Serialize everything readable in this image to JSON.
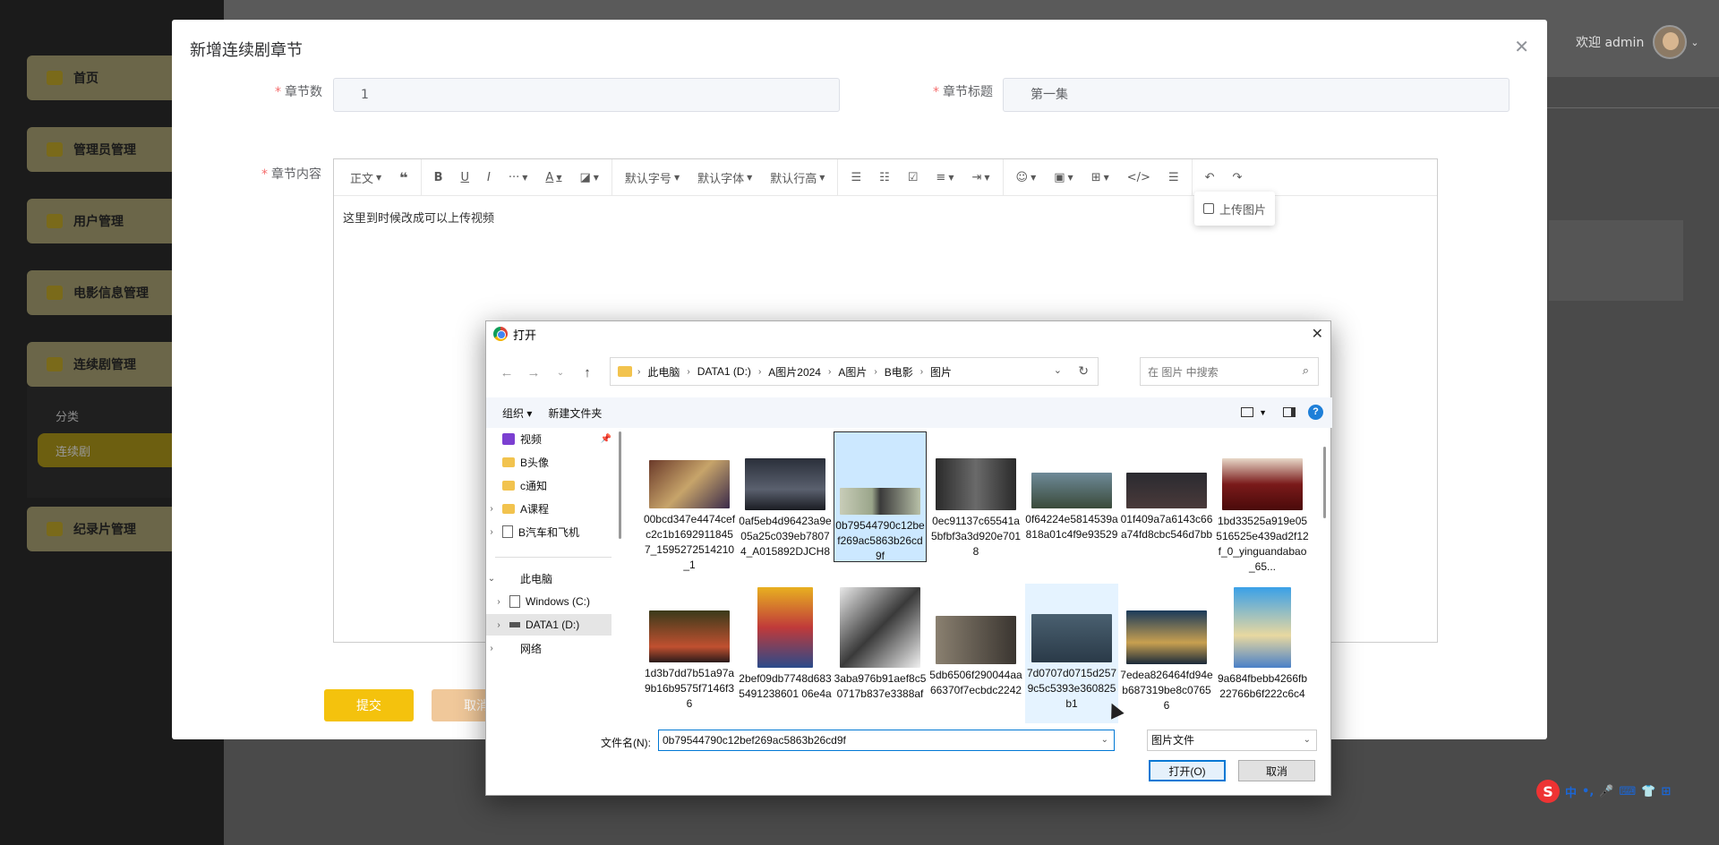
{
  "sidebar": {
    "items": [
      {
        "label": "首页"
      },
      {
        "label": "管理员管理"
      },
      {
        "label": "用户管理"
      },
      {
        "label": "电影信息管理"
      },
      {
        "label": "连续剧管理"
      },
      {
        "label": "纪录片管理"
      }
    ],
    "sub_items": [
      {
        "label": "分类"
      },
      {
        "label": "连续剧"
      }
    ]
  },
  "header": {
    "welcome": "欢迎 admin"
  },
  "dialog": {
    "title": "新增连续剧章节",
    "fields": {
      "chapter_num_label": "章节数",
      "chapter_num_value": "1",
      "chapter_title_label": "章节标题",
      "chapter_title_value": "第一集",
      "content_label": "章节内容"
    },
    "toolbar": {
      "paragraph": "正文",
      "font_size": "默认字号",
      "font_family": "默认字体",
      "line_height": "默认行高"
    },
    "editor_text": "这里到时候改成可以上传视频",
    "image_menu": {
      "upload_image": "上传图片"
    },
    "buttons": {
      "submit": "提交",
      "cancel": "取消"
    }
  },
  "file_dialog": {
    "title": "打开",
    "breadcrumb": [
      "此电脑",
      "DATA1 (D:)",
      "A图片2024",
      "A图片",
      "B电影",
      "图片"
    ],
    "search_placeholder": "在 图片 中搜索",
    "commands": {
      "organize": "组织",
      "new_folder": "新建文件夹"
    },
    "tree": [
      {
        "label": "视频"
      },
      {
        "label": "B头像"
      },
      {
        "label": "c通知"
      },
      {
        "label": "A课程"
      },
      {
        "label": "B汽车和飞机"
      },
      {
        "label": "此电脑"
      },
      {
        "label": "Windows (C:)"
      },
      {
        "label": "DATA1 (D:)"
      },
      {
        "label": "网络"
      }
    ],
    "files": [
      {
        "name": "00bcd347e4474cefc2c1b16929118457_1595272514210_1"
      },
      {
        "name": "0af5eb4d96423a9e05a25c039eb78074_A015892DJCH8"
      },
      {
        "name": "0b79544790c12bef269ac5863b26cd9f"
      },
      {
        "name": "0ec91137c65541a5bfbf3a3d920e7018"
      },
      {
        "name": "0f64224e5814539a818a01c4f9e93529"
      },
      {
        "name": "01f409a7a6143c66a74fd8cbc546d7bb"
      },
      {
        "name": "1bd33525a919e05516525e439ad2f12f_0_yinguandabao_65..."
      },
      {
        "name": "1d3b7dd7b51a97a9b16b9575f7146f36"
      },
      {
        "name": "2bef09db7748d6835491238601 06e4a"
      },
      {
        "name": "3aba976b91aef8c50717b837e3388af"
      },
      {
        "name": "5db6506f290044aa66370f7ecbdc2242"
      },
      {
        "name": "7d0707d0715d2579c5c5393e360825b1"
      },
      {
        "name": "7edea826464fd94eb687319be8c07656"
      },
      {
        "name": "9a684fbebb4266fb22766b6f222c6c4"
      }
    ],
    "filename_label": "文件名(N):",
    "filename_value": "0b79544790c12bef269ac5863b26cd9f",
    "filetype": "图片文件",
    "open_button": "打开(O)",
    "cancel_button": "取消"
  },
  "ime": {
    "label": "中"
  }
}
